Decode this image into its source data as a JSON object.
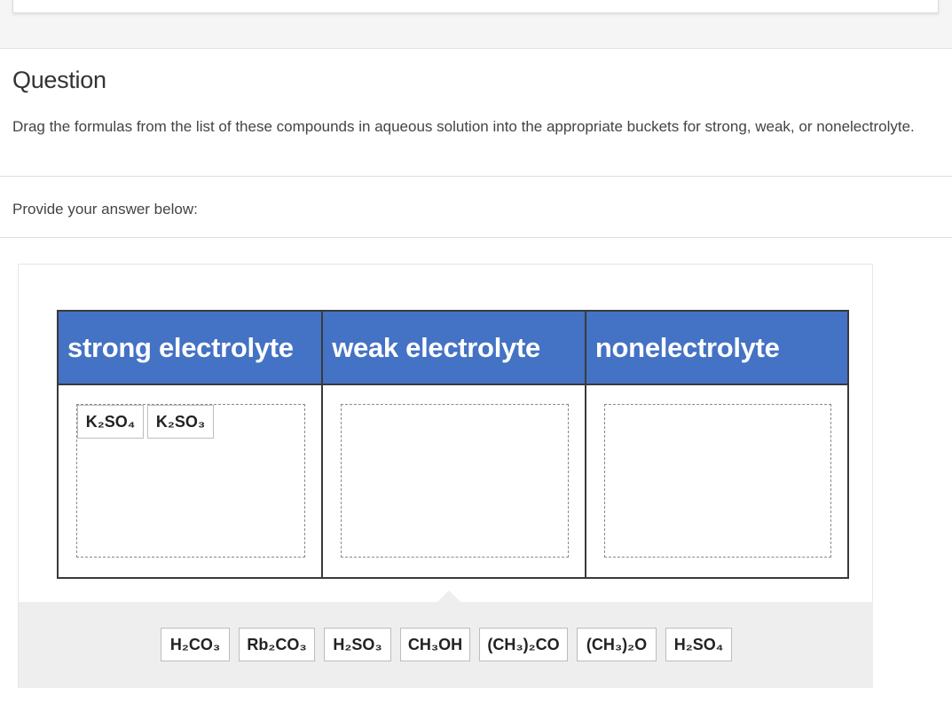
{
  "question": {
    "title": "Question",
    "text": "Drag the formulas from the list of these compounds in aqueous solution into the appropriate buckets for strong, weak, or nonelectrolyte.",
    "prompt": "Provide your answer below:"
  },
  "buckets": [
    {
      "label": "strong electrolyte",
      "items": [
        "K₂SO₄",
        "K₂SO₃"
      ]
    },
    {
      "label": "weak electrolyte",
      "items": []
    },
    {
      "label": "nonelectrolyte",
      "items": []
    }
  ],
  "tray_items": [
    "H₂CO₃",
    "Rb₂CO₃",
    "H₂SO₃",
    "CH₃OH",
    "(CH₃)₂CO",
    "(CH₃)₂O",
    "H₂SO₄"
  ]
}
